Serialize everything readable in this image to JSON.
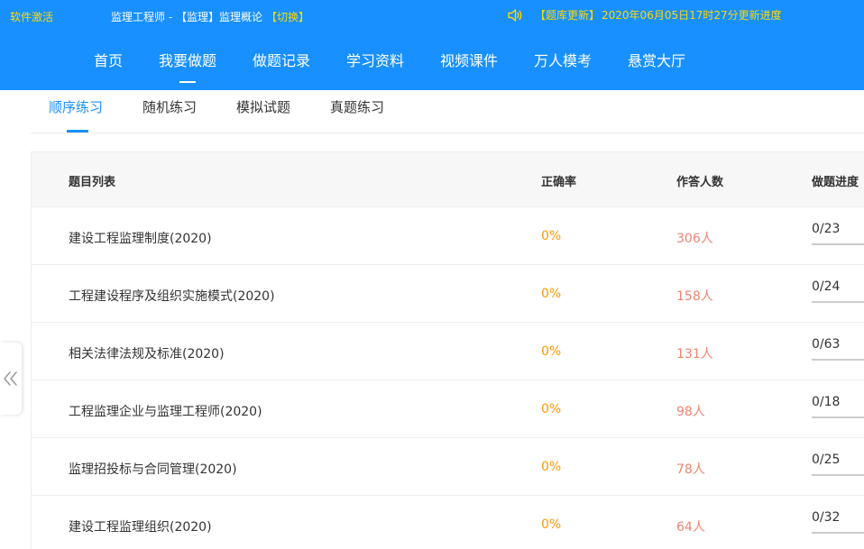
{
  "header": {
    "activate_label": "软件激活",
    "course_title": "监理工程师 - 【监理】监理概论",
    "switch_label": "【切换】",
    "update_tag": "【题库更新】",
    "update_text": "2020年06月05日17时27分更新进度",
    "speaker_icon": "speaker-icon"
  },
  "nav": {
    "items": [
      "首页",
      "我要做题",
      "做题记录",
      "学习资料",
      "视频课件",
      "万人模考",
      "悬赏大厅"
    ],
    "active_index": 1
  },
  "subtabs": {
    "items": [
      "顺序练习",
      "随机练习",
      "模拟试题",
      "真题练习"
    ],
    "active_index": 0
  },
  "table": {
    "headers": [
      "题目列表",
      "正确率",
      "作答人数",
      "做题进度"
    ],
    "rows": [
      {
        "title": "建设工程监理制度(2020)",
        "rate": "0%",
        "count": "306人",
        "progress": "0/23"
      },
      {
        "title": "工程建设程序及组织实施模式(2020)",
        "rate": "0%",
        "count": "158人",
        "progress": "0/24"
      },
      {
        "title": "相关法律法规及标准(2020)",
        "rate": "0%",
        "count": "131人",
        "progress": "0/63"
      },
      {
        "title": "工程监理企业与监理工程师(2020)",
        "rate": "0%",
        "count": "98人",
        "progress": "0/18"
      },
      {
        "title": "监理招投标与合同管理(2020)",
        "rate": "0%",
        "count": "78人",
        "progress": "0/25"
      },
      {
        "title": "建设工程监理组织(2020)",
        "rate": "0%",
        "count": "64人",
        "progress": "0/32"
      }
    ]
  },
  "colors": {
    "brand": "#1890ff",
    "highlight": "#ffd900",
    "rate": "#ff9900",
    "count": "#f08470"
  }
}
